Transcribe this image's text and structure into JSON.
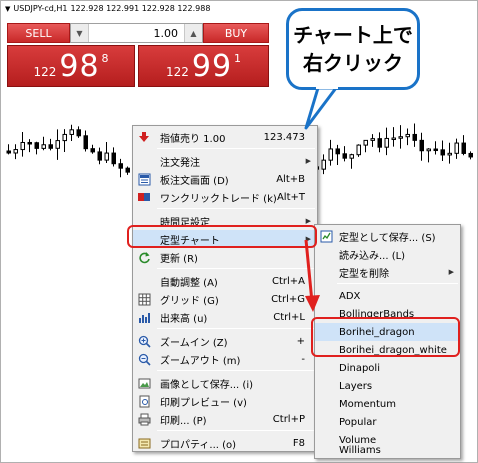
{
  "chart": {
    "symbol_title": "USDJPY-cd,H1",
    "ohlc": "122.928 122.991 122.928 122.988"
  },
  "trade": {
    "sell_label": "SELL",
    "buy_label": "BUY",
    "lot": "1.00",
    "sell_price_small": "122",
    "sell_price_big": "98",
    "sell_price_sup": "8",
    "buy_price_small": "122",
    "buy_price_big": "99",
    "buy_price_sup": "1"
  },
  "callout": {
    "line1": "チャート上で",
    "line2": "右クリック",
    "border_color": "#1a73c8"
  },
  "context_menu": {
    "items": [
      {
        "label": "指値売り 1.00",
        "shortcut": "123.473",
        "icon": "sell-arrow-icon"
      },
      {
        "label": "注文発注",
        "shortcut": "",
        "icon": "",
        "submenu": true
      },
      {
        "label": "板注文画面 (D)",
        "shortcut": "Alt+B",
        "icon": "order-board-icon"
      },
      {
        "label": "ワンクリックトレード (k)",
        "shortcut": "Alt+T",
        "icon": "one-click-trade-icon"
      },
      {
        "label": "時間足設定",
        "shortcut": "",
        "icon": "",
        "submenu": true
      },
      {
        "label": "定型チャート",
        "shortcut": "",
        "icon": "",
        "submenu": true,
        "highlighted": true
      },
      {
        "label": "更新 (R)",
        "shortcut": "",
        "icon": "refresh-icon"
      },
      {
        "label": "自動調整 (A)",
        "shortcut": "Ctrl+A",
        "icon": ""
      },
      {
        "label": "グリッド (G)",
        "shortcut": "Ctrl+G",
        "icon": "grid-icon"
      },
      {
        "label": "出来高 (u)",
        "shortcut": "Ctrl+L",
        "icon": "volume-icon"
      },
      {
        "label": "ズームイン (Z)",
        "shortcut": "+",
        "icon": "zoom-in-icon"
      },
      {
        "label": "ズームアウト (m)",
        "shortcut": "-",
        "icon": "zoom-out-icon"
      },
      {
        "label": "画像として保存... (i)",
        "shortcut": "",
        "icon": "save-image-icon"
      },
      {
        "label": "印刷プレビュー (v)",
        "shortcut": "",
        "icon": "print-preview-icon"
      },
      {
        "label": "印刷... (P)",
        "shortcut": "Ctrl+P",
        "icon": "print-icon"
      },
      {
        "label": "プロパティ... (o)",
        "shortcut": "F8",
        "icon": "properties-icon"
      }
    ]
  },
  "template_submenu": {
    "items": [
      {
        "label": "定型として保存... (S)",
        "icon": "template-save-icon"
      },
      {
        "label": "読み込み... (L)",
        "icon": ""
      },
      {
        "label": "定型を削除",
        "icon": "",
        "submenu": true
      },
      {
        "label": "ADX",
        "icon": ""
      },
      {
        "label": "BollingerBands",
        "icon": ""
      },
      {
        "label": "Borihei_dragon",
        "icon": "",
        "highlighted": true
      },
      {
        "label": "Borihei_dragon_white",
        "icon": ""
      },
      {
        "label": "Dinapoli",
        "icon": ""
      },
      {
        "label": "Layers",
        "icon": ""
      },
      {
        "label": "Momentum",
        "icon": ""
      },
      {
        "label": "Popular",
        "icon": ""
      },
      {
        "label": "Volume",
        "icon": ""
      },
      {
        "label": "Williams",
        "icon": ""
      }
    ]
  },
  "colors": {
    "highlight": "#e0201e",
    "accent": "#1a73c8",
    "sell_buy": "#c82828"
  }
}
